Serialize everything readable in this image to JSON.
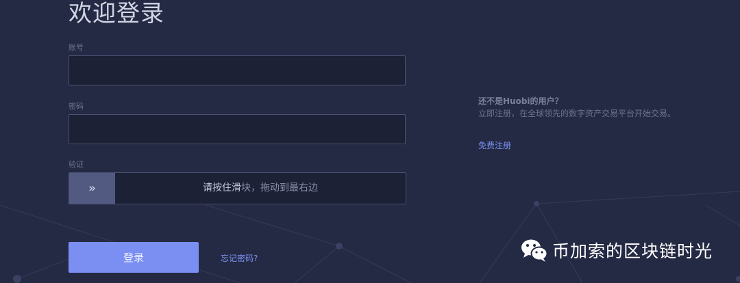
{
  "login": {
    "title": "欢迎登录",
    "account_label": "账号",
    "account_value": "",
    "password_label": "密码",
    "password_value": "",
    "verify_label": "验证",
    "slider_handle_glyph": "»",
    "slider_text_highlight": "请按住滑",
    "slider_text_rest": "块，拖动到最右边",
    "login_button": "登录",
    "forgot_link": "忘记密码?"
  },
  "promo": {
    "title": "还不是Huobi的用户？",
    "description": "立即注册，在全球领先的数字资产交易平台开始交易。",
    "register_link": "免费注册"
  },
  "watermark": {
    "text": "币加索的区块链时光",
    "icon": "wechat-icon"
  },
  "colors": {
    "background": "#252a44",
    "input_background": "#1d2135",
    "accent": "#7b8ff2",
    "link": "#7b93f5"
  }
}
